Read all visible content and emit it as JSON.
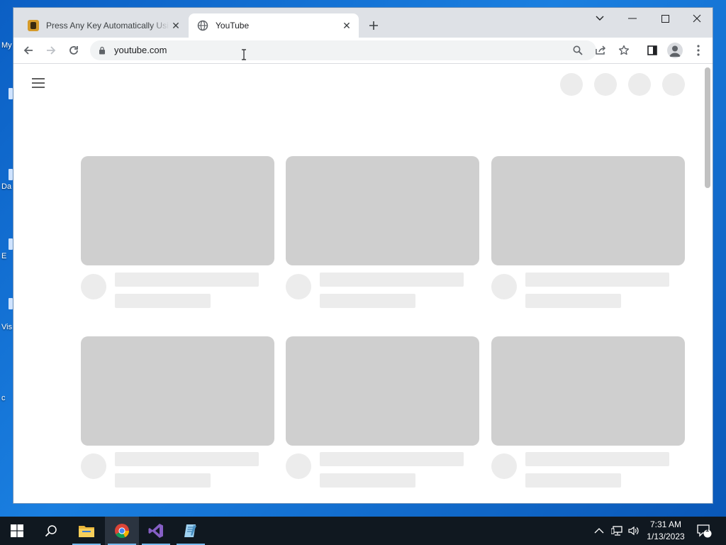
{
  "desktop": {
    "icon_labels": [
      "My",
      "Da",
      "E",
      "Vis",
      "c"
    ]
  },
  "browser": {
    "tabs": [
      {
        "title": "Press Any Key Automatically Using AutoHotkey",
        "favicon": "autohotkey-icon",
        "active": false
      },
      {
        "title": "YouTube",
        "favicon": "globe-icon",
        "active": true
      }
    ],
    "new_tab_icon": "plus-icon",
    "window_controls": [
      "tab-search-icon",
      "minimize-icon",
      "maximize-icon",
      "close-icon"
    ],
    "toolbar": {
      "back_icon": "arrow-left-icon",
      "forward_icon": "arrow-right-icon",
      "reload_icon": "reload-icon",
      "url": "youtube.com",
      "omnibox_icons": [
        "search-icon",
        "share-icon",
        "star-icon"
      ],
      "side_panel_icon": "side-panel-icon",
      "profile_icon": "avatar-icon",
      "menu_icon": "kebab-menu-icon"
    }
  },
  "page": {
    "menu_icon": "hamburger-icon",
    "header_placeholders": 4,
    "video_rows": 2,
    "video_columns": 3,
    "placeholder_color": "#cfcfcf",
    "line_color": "#ececec"
  },
  "taskbar": {
    "apps": [
      "windows-start-icon",
      "search-icon",
      "file-explorer-icon",
      "chrome-icon",
      "visual-studio-icon",
      "notepad-icon"
    ],
    "active_app": "chrome-icon",
    "tray_icons": [
      "chevron-up-icon",
      "network-icon",
      "volume-icon"
    ],
    "time": "7:31 AM",
    "date": "1/13/2023",
    "notification_count": "1"
  }
}
